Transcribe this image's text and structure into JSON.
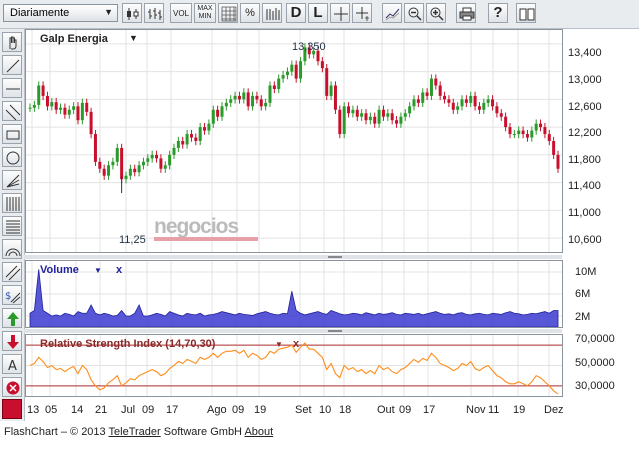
{
  "toolbar": {
    "period": "Diariamente",
    "vol": "VOL",
    "maxmin_top": "MAX",
    "maxmin_bottom": "MIN",
    "percent": "%",
    "d": "D",
    "l": "L"
  },
  "main_chart": {
    "title": "Galp Energia",
    "high_label": "13,350",
    "low_label": "11,25",
    "watermark": "negocios",
    "y_ticks": [
      "13,400",
      "13,000",
      "12,600",
      "12,200",
      "11,800",
      "11,400",
      "11,000",
      "10,600"
    ]
  },
  "volume_chart": {
    "title": "Volume",
    "close": "x",
    "y_ticks": [
      "10M",
      "6M",
      "2M"
    ]
  },
  "rsi_chart": {
    "title": "Relative Strength Index (14,70,30)",
    "close": "x",
    "y_ticks": [
      "70,0000",
      "50,0000",
      "30,0000"
    ]
  },
  "x_axis": [
    "13",
    "05",
    "14",
    "21",
    "Jul",
    "09",
    "17",
    "Ago",
    "09",
    "19",
    "Set",
    "10",
    "18",
    "Out",
    "09",
    "17",
    "Nov",
    "11",
    "19",
    "Dez"
  ],
  "footer": {
    "prefix": "FlashChart – © 2013 ",
    "company": "TeleTrader",
    "middle": " Software GmbH ",
    "about": "About"
  },
  "colors": {
    "up": "#2a9a2a",
    "down": "#c8102e",
    "volume": "#3a3ad0",
    "rsi": "#ff8c1a",
    "accent": "#c8102e"
  },
  "chart_data": {
    "type": "candlestick",
    "x_labels": [
      "13",
      "05",
      "14",
      "21",
      "Jul",
      "09",
      "17",
      "Ago",
      "09",
      "19",
      "Set",
      "10",
      "18",
      "Out",
      "09",
      "17",
      "Nov",
      "11",
      "19",
      "Dez"
    ],
    "price_range": [
      10400,
      13600
    ],
    "annotations": {
      "max": 13350,
      "min": 11250
    },
    "closes": [
      12480,
      12520,
      12800,
      12650,
      12500,
      12560,
      12450,
      12480,
      12380,
      12450,
      12500,
      12300,
      12550,
      12420,
      12100,
      11700,
      11600,
      11500,
      11650,
      11700,
      11900,
      11450,
      11500,
      11600,
      11550,
      11650,
      11700,
      11750,
      11800,
      11750,
      11600,
      11650,
      11800,
      11900,
      12000,
      11950,
      12100,
      12050,
      12000,
      12200,
      12150,
      12250,
      12450,
      12350,
      12500,
      12550,
      12600,
      12650,
      12600,
      12700,
      12500,
      12650,
      12600,
      12500,
      12550,
      12800,
      12750,
      12900,
      12950,
      13000,
      13100,
      12900,
      13150,
      13350,
      13250,
      13300,
      13150,
      13050,
      12650,
      12800,
      12450,
      12100,
      12500,
      12400,
      12450,
      12350,
      12400,
      12300,
      12350,
      12250,
      12450,
      12350,
      12400,
      12300,
      12250,
      12350,
      12400,
      12500,
      12600,
      12550,
      12700,
      12650,
      12900,
      12800,
      12650,
      12600,
      12550,
      12450,
      12500,
      12600,
      12550,
      12650,
      12500,
      12450,
      12550,
      12600,
      12500,
      12400,
      12350,
      12200,
      12100,
      12100,
      12150,
      12100,
      12050,
      12150,
      12250,
      12200,
      12100,
      12000,
      11800,
      11600
    ],
    "volume_millions": [
      2.5,
      3,
      10.5,
      3,
      2.5,
      2,
      2.2,
      2,
      2.5,
      2.3,
      2,
      2.8,
      2.5,
      2.5,
      4,
      2.5,
      2.2,
      2.5,
      2.3,
      2,
      2.1,
      3,
      2,
      2,
      2.5,
      4,
      2,
      2,
      2.2,
      2.5,
      2.3,
      2,
      2.8,
      2.5,
      2.2,
      2,
      2.5,
      2.3,
      2.2,
      2.5,
      2,
      2.2,
      2.3,
      2.5,
      2.8,
      2.6,
      2.4,
      2.2,
      2.5,
      2.3,
      2.2,
      2.1,
      2.4,
      2.6,
      2.8,
      2.5,
      2.3,
      2.2,
      2.5,
      2.4,
      6.5,
      3,
      2.5,
      2.2,
      2.4,
      2.6,
      2.8,
      2.5,
      2.3,
      3,
      2.7,
      2.4,
      2.2,
      2.3,
      2.5,
      2.4,
      2.2,
      2.6,
      2.4,
      2.2,
      2.5,
      2.3,
      2.4,
      2.6,
      2.3,
      2.2,
      2.5,
      2.4,
      2.3,
      2.5,
      2.2,
      2.4,
      2.6,
      2.8,
      2.5,
      2.3,
      2.4,
      2.2,
      2.5,
      2.6,
      2.3,
      2.2,
      2.4,
      2.5,
      2.3,
      2.2,
      2.5,
      2.4,
      2.3,
      2.6,
      2.8,
      2.5,
      2.4,
      2.2,
      2.3,
      2.5,
      2.4,
      2.6,
      2.8,
      2.5,
      3,
      3
    ],
    "rsi": [
      50,
      52,
      58,
      54,
      48,
      50,
      46,
      47,
      44,
      47,
      49,
      42,
      50,
      46,
      36,
      30,
      26,
      28,
      33,
      36,
      40,
      30,
      33,
      37,
      36,
      40,
      42,
      44,
      46,
      44,
      40,
      42,
      47,
      50,
      54,
      52,
      56,
      54,
      52,
      58,
      56,
      58,
      62,
      58,
      62,
      64,
      64,
      65,
      62,
      65,
      58,
      62,
      60,
      56,
      58,
      64,
      62,
      66,
      67,
      68,
      70,
      63,
      68,
      72,
      66,
      66,
      62,
      58,
      46,
      52,
      42,
      38,
      50,
      46,
      48,
      44,
      46,
      42,
      45,
      42,
      50,
      46,
      48,
      44,
      42,
      46,
      48,
      52,
      56,
      53,
      57,
      55,
      62,
      58,
      52,
      50,
      48,
      45,
      47,
      52,
      50,
      54,
      47,
      45,
      48,
      50,
      45,
      40,
      38,
      34,
      32,
      32,
      34,
      32,
      30,
      34,
      40,
      38,
      34,
      30,
      25,
      22
    ],
    "rsi_range": [
      20,
      80
    ],
    "rsi_bounds": [
      70,
      30
    ]
  }
}
